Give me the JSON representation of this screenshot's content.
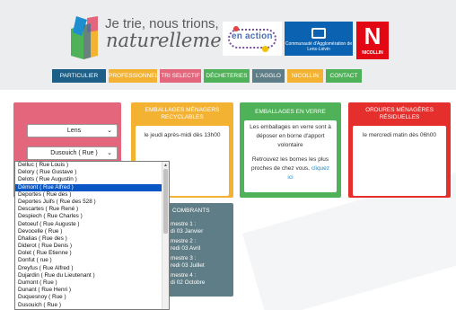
{
  "header": {
    "logo_line1": "Je trie, nous trions,",
    "logo_line2": "naturellement",
    "logo_bang": "!",
    "partner_enaction": "en action",
    "partner_community": "Communauté d'Agglomération de Lens-Liévin",
    "partner_nicollin_letter": "N",
    "partner_nicollin_name": "NICOLLIN"
  },
  "nav": [
    {
      "label": "PARTICULIER",
      "color": "#1d5f86"
    },
    {
      "label": "PROFESSIONNEL",
      "color": "#f4b232"
    },
    {
      "label": "TRI SELECTIF",
      "color": "#e3667c"
    },
    {
      "label": "DÉCHETERIES",
      "color": "#4fb258"
    },
    {
      "label": "L'AGGLO",
      "color": "#5f7d86"
    },
    {
      "label": "NICOLLIN",
      "color": "#f4b232"
    },
    {
      "label": "CONTACT",
      "color": "#4fb258"
    }
  ],
  "search": {
    "city_value": "Lens",
    "street_value": "Dusouich ( Rue )"
  },
  "cards": {
    "yellow": {
      "title": "EMBALLAGES MÉNAGERS RECYCLABLES",
      "body": "le jeudi après-midi dès 13h00"
    },
    "green": {
      "title": "EMBALLAGES EN VERRE",
      "body": "Les emballages en verre sont à déposer en borne d'apport volontaire",
      "body2": "Retrouvez les bornes les plus proches de chez vous,",
      "link": "cliquez ici"
    },
    "red": {
      "title": "ORDURES MÉNAGÈRES RÉSIDUELLES",
      "body": "le mercredi matin dès 06h00"
    },
    "grey": {
      "title": "COMBRANTS",
      "lines": [
        "mestre 1 :",
        "di 03 Janvier",
        "mestre 2 :",
        "redi 03 Avril",
        "mestre 3 :",
        "redi 03 Juillet",
        "mestre 4 :",
        "di 02 Octobre"
      ]
    }
  },
  "dropdown": {
    "items": [
      "Delluc ( Rue Louis )",
      "Delory ( Rue Gustave )",
      "Delots ( Rue Augustin )",
      "Démont ( Rue Alfred )",
      "Deportes ( Rue des )",
      "Deportes Juifs ( Rue des 528 )",
      "Descartes ( Rue René )",
      "Despiech ( Rue Charles )",
      "Detoeuf ( Rue Auguste )",
      "Devocelle ( Rue )",
      "Dhalias ( Rue des )",
      "Diderot ( Rue Denis )",
      "Dolet ( Rue Etienne )",
      "Donfut ( rue )",
      "Dreyfus ( Rue Alfred )",
      "Dujardin ( Rue du Lieutenant )",
      "Dumont ( Rue )",
      "Dunant ( Rue Henri )",
      "Duquesnoy ( Rue )",
      "Dusouich ( Rue )"
    ],
    "selected_index": 3
  }
}
